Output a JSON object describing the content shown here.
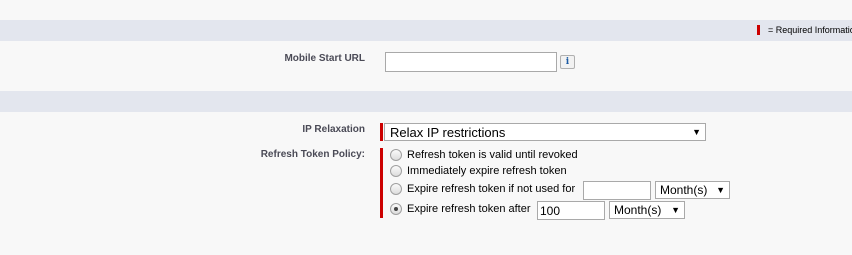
{
  "required_legend": {
    "text": "= Required Information"
  },
  "mobile_start_url": {
    "label": "Mobile Start URL",
    "value": "",
    "info_icon": "i"
  },
  "ip_relaxation": {
    "label": "IP Relaxation",
    "selected": "Relax IP restrictions"
  },
  "refresh_token_policy": {
    "label": "Refresh Token Policy:",
    "options": [
      {
        "label": "Refresh token is valid until revoked",
        "checked": false
      },
      {
        "label": "Immediately expire refresh token",
        "checked": false
      },
      {
        "label": "Expire refresh token if not used for",
        "checked": false,
        "value": "",
        "unit": "Month(s)"
      },
      {
        "label": "Expire refresh token after",
        "checked": true,
        "value": "100",
        "unit": "Month(s)"
      }
    ]
  },
  "colors": {
    "required": "#cc0000",
    "section_band": "#e3e6ee",
    "label": "#4a4a56",
    "info_icon": "#1a5aa3"
  },
  "icons": {
    "dropdown": "triangle-down",
    "info": "info-icon"
  }
}
